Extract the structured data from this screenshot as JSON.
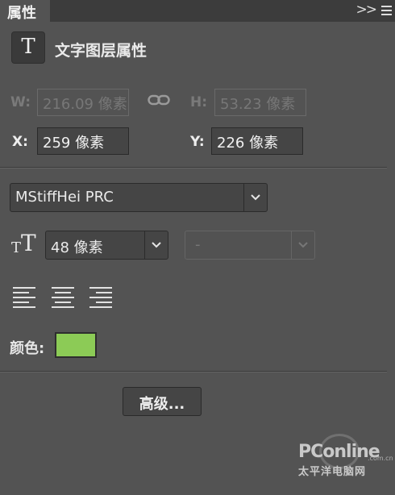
{
  "panel": {
    "tab_label": "属性",
    "collapse_glyph": ">>"
  },
  "header": {
    "type_icon_glyph": "T",
    "title": "文字图层属性"
  },
  "transform": {
    "w_label": "W:",
    "w_value": "216.09 像素",
    "h_label": "H:",
    "h_value": "53.23 像素",
    "x_label": "X:",
    "x_value": "259 像素",
    "y_label": "Y:",
    "y_value": "226 像素"
  },
  "font": {
    "family": "MStiffHei PRC",
    "size": "48 像素",
    "style": "-",
    "size_icon_small": "T",
    "size_icon_large": "T"
  },
  "color": {
    "label": "颜色:",
    "value": "#8ccb56"
  },
  "actions": {
    "advanced_label": "高级..."
  },
  "watermark": {
    "brand": "PConline",
    "tld": ".com.cn",
    "subtitle": "太平洋电脑网"
  }
}
